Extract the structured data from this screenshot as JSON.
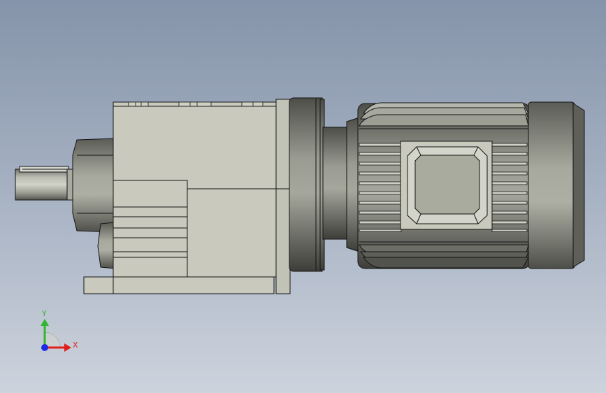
{
  "viewport": {
    "background_top": "#8594aa",
    "background_bottom": "#cdd3dd"
  },
  "model": {
    "part_color": "#c9cabd",
    "metal_color": "#a9aaa0",
    "edge_color": "#141414"
  },
  "triad": {
    "x_label": "X",
    "y_label": "Y",
    "x_color": "#e0201a",
    "y_color": "#2db82d",
    "z_color": "#1c2ce0"
  }
}
